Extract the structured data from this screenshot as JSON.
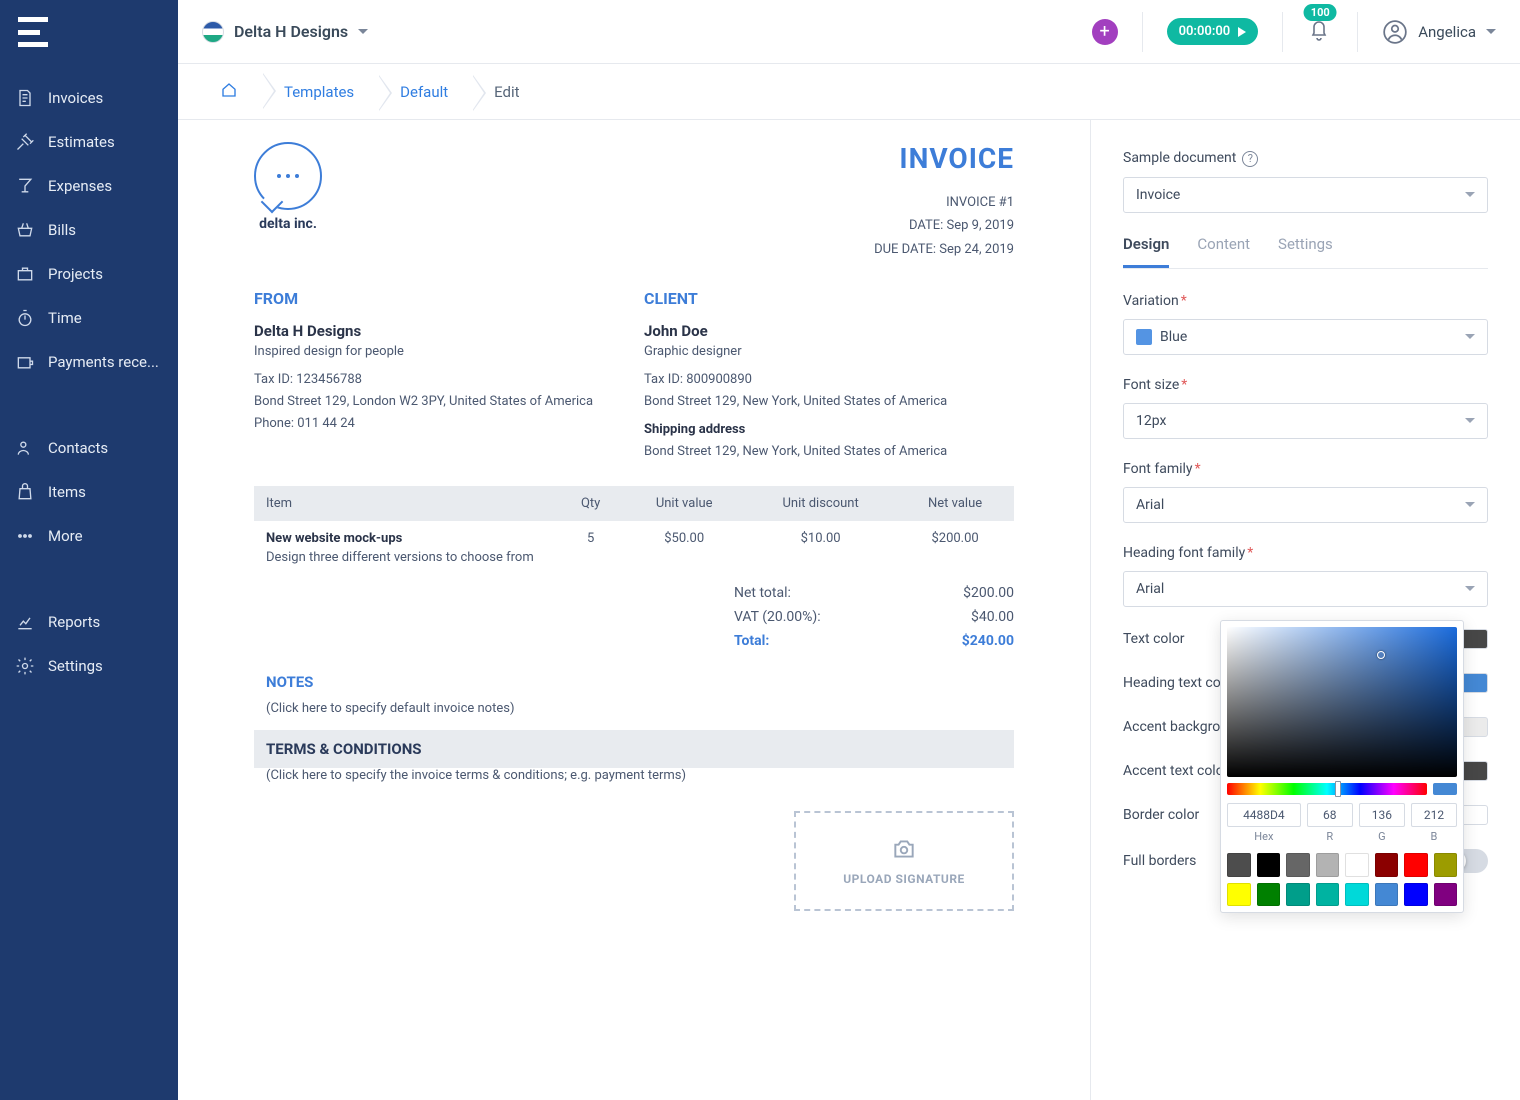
{
  "sidebar": {
    "items": [
      {
        "label": "Invoices",
        "icon": "file-invoice"
      },
      {
        "label": "Estimates",
        "icon": "gavel"
      },
      {
        "label": "Expenses",
        "icon": "martini"
      },
      {
        "label": "Bills",
        "icon": "basket"
      },
      {
        "label": "Projects",
        "icon": "briefcase"
      },
      {
        "label": "Time",
        "icon": "stopwatch"
      },
      {
        "label": "Payments rece...",
        "icon": "wallet"
      }
    ],
    "items2": [
      {
        "label": "Contacts",
        "icon": "users"
      },
      {
        "label": "Items",
        "icon": "bag"
      },
      {
        "label": "More",
        "icon": "dots"
      }
    ],
    "items3": [
      {
        "label": "Reports",
        "icon": "chart"
      },
      {
        "label": "Settings",
        "icon": "gear"
      }
    ]
  },
  "topbar": {
    "org": "Delta H Designs",
    "timer": "00:00:00",
    "notifications": "100",
    "user": "Angelica"
  },
  "breadcrumb": [
    "Templates",
    "Default",
    "Edit"
  ],
  "invoice": {
    "title": "INVOICE",
    "logo_name": "delta inc.",
    "number": "INVOICE #1",
    "date": "DATE: Sep 9, 2019",
    "due": "DUE DATE: Sep 24, 2019",
    "from": {
      "heading": "FROM",
      "name": "Delta H Designs",
      "sub": "Inspired design for people",
      "tax": "Tax ID: 123456788",
      "addr": "Bond Street 129, London W2 3PY, United States of America",
      "phone": "Phone: 011 44 24"
    },
    "client": {
      "heading": "CLIENT",
      "name": "John Doe",
      "sub": "Graphic designer",
      "tax": "Tax ID: 800900890",
      "addr": "Bond Street 129, New York, United States of America",
      "ship_lbl": "Shipping address",
      "ship": "Bond Street 129, New York, United States of America"
    },
    "cols": {
      "item": "Item",
      "qty": "Qty",
      "unit": "Unit value",
      "disc": "Unit discount",
      "net": "Net value"
    },
    "line": {
      "name": "New website mock-ups",
      "desc": "Design three different versions to choose from",
      "qty": "5",
      "unit": "$50.00",
      "disc": "$10.00",
      "net": "$200.00"
    },
    "totals": {
      "net_lbl": "Net total:",
      "net": "$200.00",
      "vat_lbl": "VAT (20.00%):",
      "vat": "$40.00",
      "total_lbl": "Total:",
      "total": "$240.00"
    },
    "notes": {
      "h": "NOTES",
      "body": "(Click here to specify default invoice notes)"
    },
    "terms": {
      "h": "TERMS & CONDITIONS",
      "body": "(Click here to specify the invoice terms & conditions; e.g. payment terms)"
    },
    "signature": "UPLOAD SIGNATURE"
  },
  "panel": {
    "sample_lbl": "Sample document",
    "sample_val": "Invoice",
    "tabs": [
      "Design",
      "Content",
      "Settings"
    ],
    "variation_lbl": "Variation",
    "variation_val": "Blue",
    "fsize_lbl": "Font size",
    "fsize_val": "12px",
    "ffont_lbl": "Font family",
    "ffont_val": "Arial",
    "hfont_lbl": "Heading font family",
    "hfont_val": "Arial",
    "colors": {
      "text": {
        "lbl": "Text color",
        "val": "#474747"
      },
      "htext": {
        "lbl": "Heading text color",
        "val": "#4488d4"
      },
      "abg": {
        "lbl": "Accent background color",
        "val": "#ebebeb"
      },
      "atext": {
        "lbl": "Accent text color",
        "val": "#474747"
      },
      "border": {
        "lbl": "Border color",
        "val": "#ffffff"
      }
    },
    "fullborders": "Full borders"
  },
  "picker": {
    "hex": "4488D4",
    "r": "68",
    "g": "136",
    "b": "212",
    "hex_lbl": "Hex",
    "r_lbl": "R",
    "g_lbl": "G",
    "b_lbl": "B",
    "presets": [
      "#4d4d4d",
      "#000000",
      "#666666",
      "#b3b3b3",
      "#ffffff",
      "#8b0000",
      "#ff0000",
      "#9c9c00",
      "#ffff00",
      "#008000",
      "#009e8a",
      "#00b3a1",
      "#00d9d9",
      "#4488d4",
      "#0000ff",
      "#800080"
    ]
  }
}
